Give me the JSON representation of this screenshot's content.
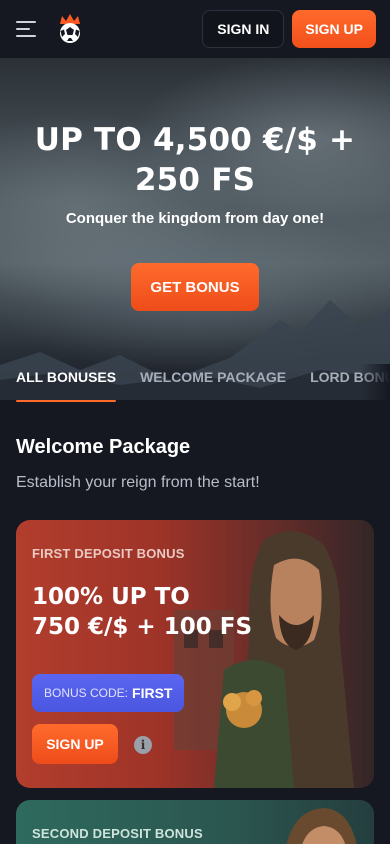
{
  "header": {
    "menu_icon": "hamburger-menu-icon",
    "logo_icon": "crown-ball-logo",
    "signin_label": "SIGN IN",
    "signup_label": "SIGN UP",
    "accent": "#ff6a2b"
  },
  "hero": {
    "title": "UP TO 4,500 €/$ + 250 FS",
    "subtitle": "Conquer the kingdom from day one!",
    "cta_label": "GET BONUS"
  },
  "tabs": [
    {
      "label": "ALL BONUSES",
      "active": true
    },
    {
      "label": "WELCOME PACKAGE",
      "active": false
    },
    {
      "label": "LORD BONUS",
      "active": false
    }
  ],
  "section": {
    "title": "Welcome Package",
    "subtitle": "Establish your reign from the start!"
  },
  "cards": [
    {
      "label": "FIRST DEPOSIT BONUS",
      "offer_line1": "100% UP TO",
      "offer_line2": "750 €/$ + 100 FS",
      "code_key": "BONUS CODE:",
      "code_value": "FIRST",
      "signup_label": "SIGN UP",
      "info_icon": "info-icon",
      "info_glyph": "i"
    },
    {
      "label": "SECOND DEPOSIT BONUS"
    }
  ]
}
